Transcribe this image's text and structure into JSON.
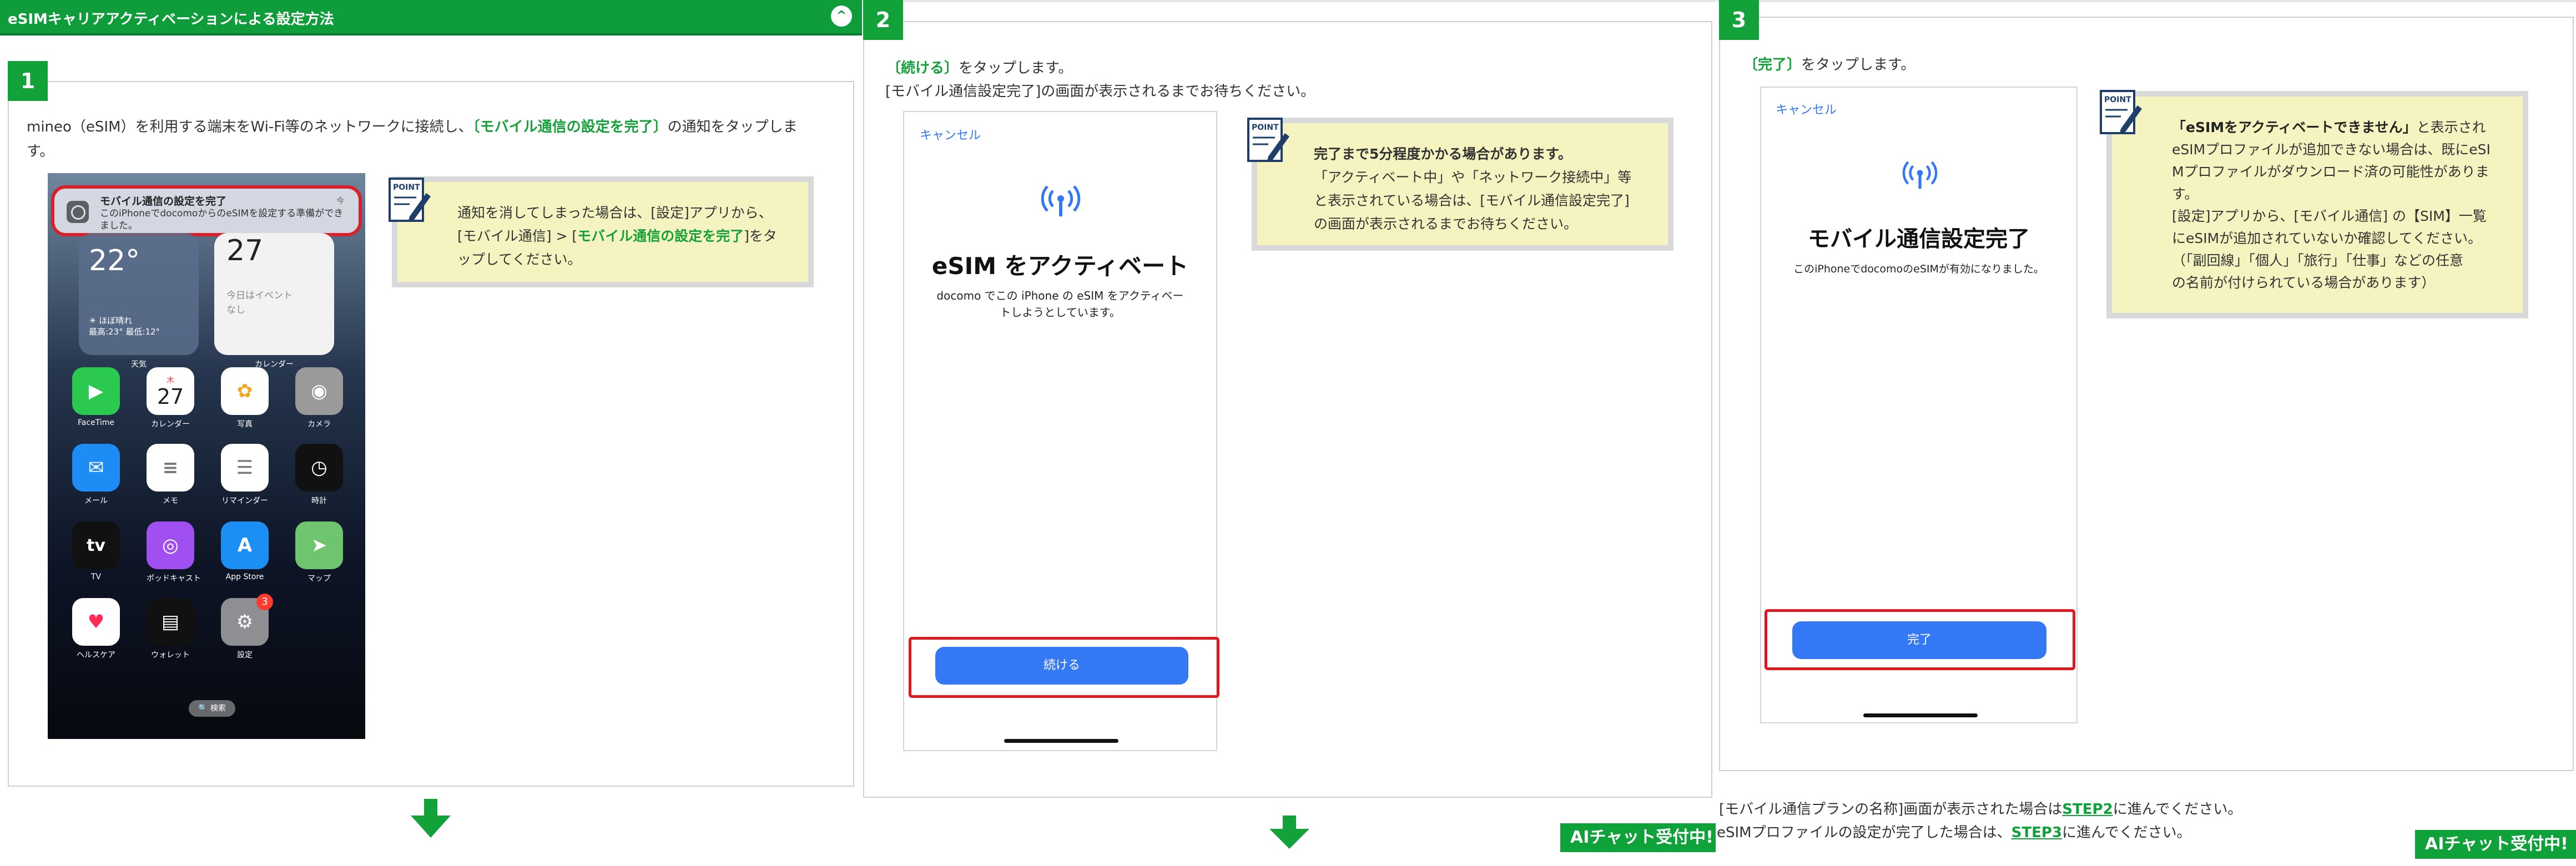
{
  "panel1": {
    "header_title": "eSIMキャリアアクティベーションによる設定方法",
    "collapse_icon": "chevron-up-icon",
    "step_number": "1",
    "instruction_pre": "mineo（eSIM）を利用する端末をWi-Fi等のネットワークに接続し、",
    "instruction_hl": "〔モバイル通信の設定を完了〕",
    "instruction_post": "の通知をタップしま",
    "instruction_line2": "す。",
    "phone": {
      "notification_title": "モバイル通信の設定を完了",
      "notification_body": "このiPhoneでdocomoからのeSIMを設定する準備ができました。",
      "notification_time": "今",
      "weather_temp": "22°",
      "weather_detail": "ほぼ晴れ\n最高:23° 最低:12°",
      "weather_label": "天気",
      "calendar_day": "27",
      "calendar_detail": "今日はイベント\nなし",
      "calendar_label": "カレンダー",
      "apps": [
        {
          "label": "FaceTime",
          "icon": "facetime-icon",
          "color": "#2bc94f"
        },
        {
          "label": "カレンダー",
          "icon": "calendar-icon",
          "color": "#ffffff"
        },
        {
          "label": "写真",
          "icon": "photos-icon",
          "color": "#ffffff"
        },
        {
          "label": "カメラ",
          "icon": "camera-icon",
          "color": "#9a9a9a"
        },
        {
          "label": "メール",
          "icon": "mail-icon",
          "color": "#1e8cf5"
        },
        {
          "label": "メモ",
          "icon": "notes-icon",
          "color": "#ffffff"
        },
        {
          "label": "リマインダー",
          "icon": "reminders-icon",
          "color": "#ffffff"
        },
        {
          "label": "時計",
          "icon": "clock-icon",
          "color": "#111111"
        },
        {
          "label": "TV",
          "icon": "tv-icon",
          "color": "#111111"
        },
        {
          "label": "ポッドキャスト",
          "icon": "podcasts-icon",
          "color": "#a04ff0"
        },
        {
          "label": "App Store",
          "icon": "app-store-icon",
          "color": "#1c8ff5"
        },
        {
          "label": "マップ",
          "icon": "maps-icon",
          "color": "#6fc46f"
        },
        {
          "label": "ヘルスケア",
          "icon": "health-icon",
          "color": "#ffffff"
        },
        {
          "label": "ウォレット",
          "icon": "wallet-icon",
          "color": "#111111"
        },
        {
          "label": "設定",
          "icon": "settings-icon",
          "color": "#8e8e93"
        }
      ],
      "calendar_app_weekday": "木",
      "calendar_app_day": "27",
      "tv_glyph": "tv",
      "settings_badge": "3",
      "search_label": "🔍 検索"
    },
    "note": {
      "line1": "通知を消してしまった場合は、[設定]アプリから、",
      "line2_pre": "[モバイル通信] > [",
      "line2_hl": "モバイル通信の設定を完了",
      "line2_post": "]をタ",
      "line3": "ップしてください。"
    },
    "down_arrow_icon": "down-arrow-icon"
  },
  "panel2": {
    "step_number": "2",
    "instr1_hl": "〔続ける〕",
    "instr1_post": "をタップします。",
    "instr2": "[モバイル通信設定完了]の画面が表示されるまでお待ちください。",
    "phone": {
      "cancel": "キャンセル",
      "signal_icon": "cellular-signal-icon",
      "title": "eSIM をアクティベート",
      "subtitle_l1": "docomo でこの iPhone の eSIM をアクティベー",
      "subtitle_l2": "トしようとしています。",
      "button": "続ける"
    },
    "note": {
      "line1": "完了まで5分程度かかる場合があります。",
      "line2": "「アクティベート中」や「ネットワーク接続中」等",
      "line3": "と表示されている場合は、[モバイル通信設定完了]",
      "line4": "の画面が表示されるまでお待ちください。"
    },
    "chat_badge": "AIチャット受付中!"
  },
  "panel3": {
    "step_number": "3",
    "instr_hl": "〔完了〕",
    "instr_post": "をタップします。",
    "phone": {
      "cancel": "キャンセル",
      "title": "モバイル通信設定完了",
      "subtitle": "このiPhoneでdocomoのeSIMが有効になりました。",
      "button": "完了"
    },
    "note": {
      "line1_hl": "「eSIMをアクティベートできません」",
      "line1_post": "と表示され",
      "line2": "eSIMプロファイルが追加できない場合は、既にeSI",
      "line3": "Mプロファイルがダウンロード済の可能性がありま",
      "line4": "す。",
      "line5": "[設定]アプリから、[モバイル通信] の【SIM】一覧",
      "line6": "にeSIMが追加されていないか確認してください。",
      "line7": "（「副回線」「個人」「旅行」「仕事」などの任意",
      "line8": "の名前が付けられている場合があります）"
    },
    "footer1_pre": "[モバイル通信プランの名称]画面が表示された場合は",
    "footer1_link": "STEP2",
    "footer1_post": "に進んでください。",
    "footer2_pre": "eSIMプロファイルの設定が完了した場合は、",
    "footer2_link": "STEP3",
    "footer2_post": "に進んでください。",
    "chat_badge": "AIチャット受付中!"
  },
  "colors": {
    "brand_green": "#13a239",
    "header_green": "#0f9c3a",
    "note_bg": "#f5f4c0",
    "highlight_red": "#e0191f",
    "ios_blue": "#3478f6"
  }
}
